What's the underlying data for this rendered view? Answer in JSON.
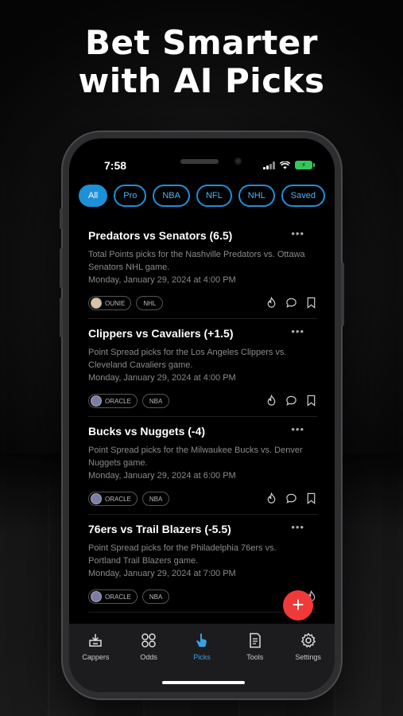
{
  "headline": {
    "line1": "Bet Smarter",
    "line2": "with AI Picks"
  },
  "status_bar": {
    "time": "7:58",
    "battery_icon": "battery-charging-icon"
  },
  "filters": [
    {
      "label": "All",
      "active": true
    },
    {
      "label": "Pro",
      "active": false
    },
    {
      "label": "NBA",
      "active": false
    },
    {
      "label": "NFL",
      "active": false
    },
    {
      "label": "NHL",
      "active": false
    },
    {
      "label": "Saved",
      "active": false
    }
  ],
  "picks": [
    {
      "title": "Predators vs Senators (6.5)",
      "description": "Total Points picks for the Nashville Predators vs. Ottawa Senators NHL game.",
      "date": "Monday, January 29, 2024 at 4:00 PM",
      "capper": "OUNIE",
      "league": "NHL"
    },
    {
      "title": "Clippers vs Cavaliers (+1.5)",
      "description": "Point Spread picks for the Los Angeles Clippers vs. Cleveland Cavaliers game.",
      "date": "Monday, January 29, 2024 at 4:00 PM",
      "capper": "ORACLE",
      "league": "NBA"
    },
    {
      "title": "Bucks vs Nuggets (-4)",
      "description": "Point Spread picks for the Milwaukee Bucks vs. Denver Nuggets game.",
      "date": "Monday, January 29, 2024 at 6:00 PM",
      "capper": "ORACLE",
      "league": "NBA"
    },
    {
      "title": "76ers vs Trail Blazers (-5.5)",
      "description": "Point Spread picks for the Philadelphia 76ers vs. Portland Trail Blazers game.",
      "date": "Monday, January 29, 2024 at 7:00 PM",
      "capper": "ORACLE",
      "league": "NBA"
    }
  ],
  "fab": {
    "label": "+"
  },
  "tabs": [
    {
      "label": "Cappers",
      "icon": "cappers-icon"
    },
    {
      "label": "Odds",
      "icon": "odds-grid-icon"
    },
    {
      "label": "Picks",
      "icon": "picks-hand-icon"
    },
    {
      "label": "Tools",
      "icon": "tools-document-icon"
    },
    {
      "label": "Settings",
      "icon": "settings-gear-icon"
    }
  ],
  "colors": {
    "accent": "#1e90d8",
    "fab": "#f03a3a",
    "active_tab": "#3aa0e8"
  }
}
